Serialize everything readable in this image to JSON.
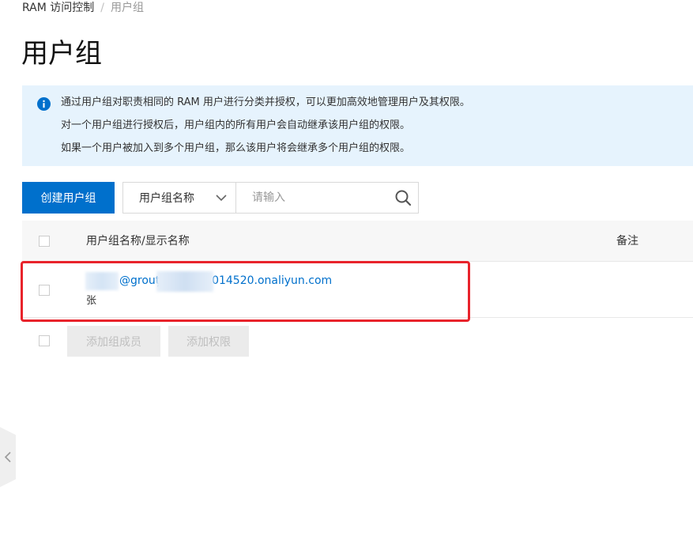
{
  "breadcrumb": {
    "root": "RAM 访问控制",
    "separator": "/",
    "current": "用户组"
  },
  "page": {
    "title": "用户组"
  },
  "notice": {
    "icon": "info-icon",
    "lines": [
      "通过用户组对职责相同的 RAM 用户进行分类并授权，可以更加高效地管理用户及其权限。",
      "对一个用户组进行授权后，用户组内的所有用户会自动继承该用户组的权限。",
      "如果一个用户被加入到多个用户组，那么该用户将会继承多个用户组的权限。"
    ]
  },
  "toolbar": {
    "create_label": "创建用户组",
    "search_field": "用户组名称",
    "search_placeholder": "请输入"
  },
  "table": {
    "columns": {
      "name": "用户组名称/显示名称",
      "remark": "备注"
    },
    "rows": [
      {
        "name_part1": "@grouț",
        "name_part2": "01014520.onaliyun.com",
        "display_name": "张"
      }
    ]
  },
  "footer": {
    "add_members_label": "添加组成员",
    "add_permissions_label": "添加权限"
  },
  "colors": {
    "primary": "#0070cc",
    "notice_bg": "#e6f3fd",
    "highlight": "#e8232b",
    "disabled_bg": "#ebebeb"
  }
}
